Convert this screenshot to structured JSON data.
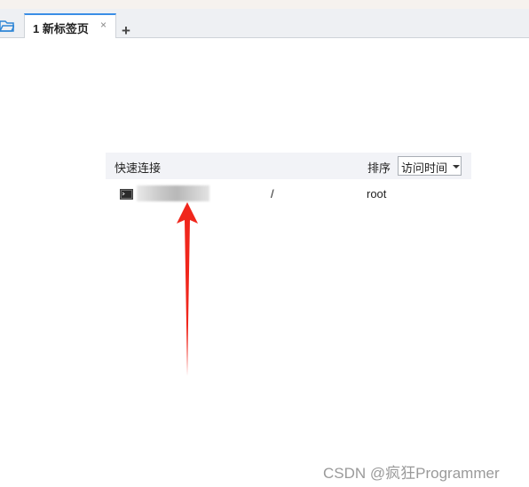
{
  "tabs": [
    {
      "label": "1 新标签页",
      "close": "×"
    }
  ],
  "tabbar": {
    "add_tab": "+"
  },
  "quick_connect": {
    "title": "快速连接",
    "sort_label": "排序",
    "sort_value": "访问时间",
    "rows": [
      {
        "host": "",
        "path": "/",
        "user": "root"
      }
    ]
  },
  "annotation": {
    "arrow_color": "#f0261c"
  },
  "colors": {
    "tab_accent": "#3a8ee6",
    "folder_icon": "#2f86d6"
  },
  "watermark": "CSDN @疯狂Programmer"
}
